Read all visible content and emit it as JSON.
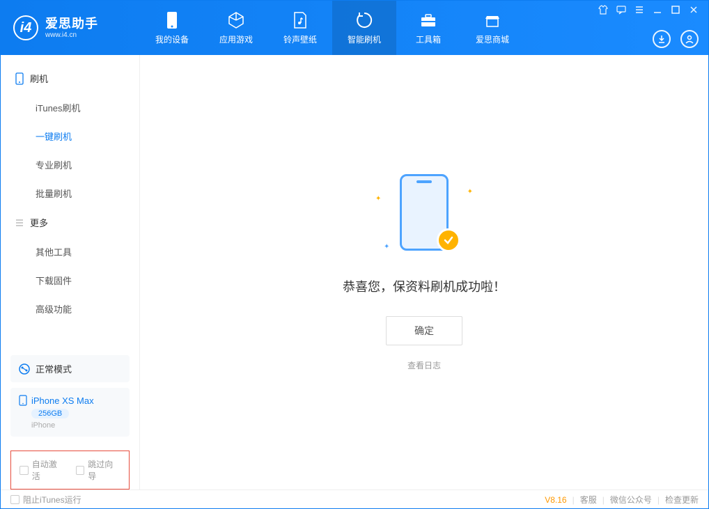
{
  "app": {
    "title": "爱思助手",
    "subtitle": "www.i4.cn"
  },
  "nav": {
    "tabs": [
      {
        "label": "我的设备"
      },
      {
        "label": "应用游戏"
      },
      {
        "label": "铃声壁纸"
      },
      {
        "label": "智能刷机"
      },
      {
        "label": "工具箱"
      },
      {
        "label": "爱思商城"
      }
    ]
  },
  "sidebar": {
    "group1": {
      "title": "刷机",
      "items": [
        "iTunes刷机",
        "一键刷机",
        "专业刷机",
        "批量刷机"
      ]
    },
    "group2": {
      "title": "更多",
      "items": [
        "其他工具",
        "下载固件",
        "高级功能"
      ]
    },
    "status": {
      "label": "正常模式"
    },
    "device": {
      "name": "iPhone XS Max",
      "capacity": "256GB",
      "type": "iPhone"
    },
    "checkboxes": {
      "auto_activate": "自动激活",
      "skip_guide": "跳过向导"
    }
  },
  "main": {
    "success_message": "恭喜您，保资料刷机成功啦！",
    "ok_button": "确定",
    "view_log": "查看日志"
  },
  "footer": {
    "block_itunes": "阻止iTunes运行",
    "version": "V8.16",
    "links": [
      "客服",
      "微信公众号",
      "检查更新"
    ]
  }
}
